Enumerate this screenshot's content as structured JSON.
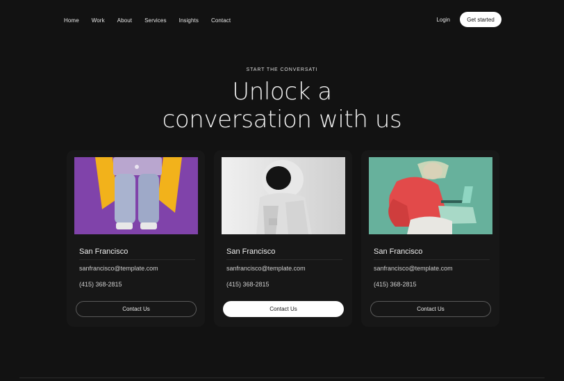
{
  "nav": {
    "items": [
      "Home",
      "Work",
      "About",
      "Services",
      "Insights",
      "Contact"
    ],
    "login": "Login",
    "cta": "Get started"
  },
  "hero": {
    "eyebrow": "START THE CONVERSATI",
    "title_line1": "Unlock a",
    "title_line2": "conversation with us"
  },
  "cards": [
    {
      "city": "San Francisco",
      "email": "sanfrancisco@template.com",
      "phone": "(415) 368-2815",
      "button": "Contact Us",
      "image": "person-with-laptop-purple"
    },
    {
      "city": "San Francisco",
      "email": "sanfrancisco@template.com",
      "phone": "(415) 368-2815",
      "button": "Contact Us",
      "image": "astronaut-grey"
    },
    {
      "city": "San Francisco",
      "email": "sanfrancisco@template.com",
      "phone": "(415) 368-2815",
      "button": "Contact Us",
      "image": "person-red-jacket-teal"
    }
  ],
  "colors": {
    "background": "#121212",
    "card": "#171717",
    "accent": "#ffffff"
  }
}
